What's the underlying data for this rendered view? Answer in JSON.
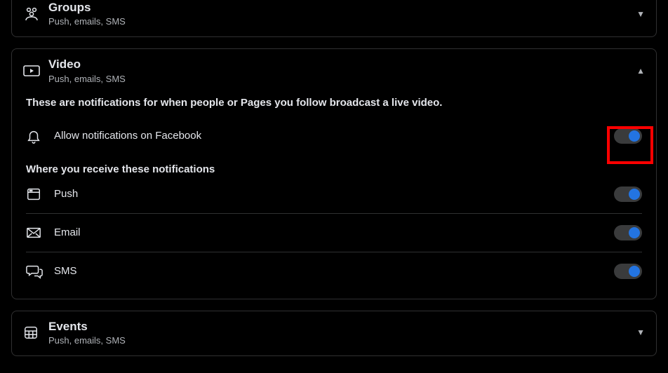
{
  "sections": {
    "groups": {
      "title": "Groups",
      "subtitle": "Push, emails, SMS",
      "expanded": false
    },
    "video": {
      "title": "Video",
      "subtitle": "Push, emails, SMS",
      "expanded": true,
      "description": "These are notifications for when people or Pages you follow broadcast a live video.",
      "allow_label": "Allow notifications on Facebook",
      "allow_on": true,
      "where_heading": "Where you receive these notifications",
      "channels": {
        "push": {
          "label": "Push",
          "on": true
        },
        "email": {
          "label": "Email",
          "on": true
        },
        "sms": {
          "label": "SMS",
          "on": true
        }
      }
    },
    "events": {
      "title": "Events",
      "subtitle": "Push, emails, SMS",
      "expanded": false
    }
  }
}
